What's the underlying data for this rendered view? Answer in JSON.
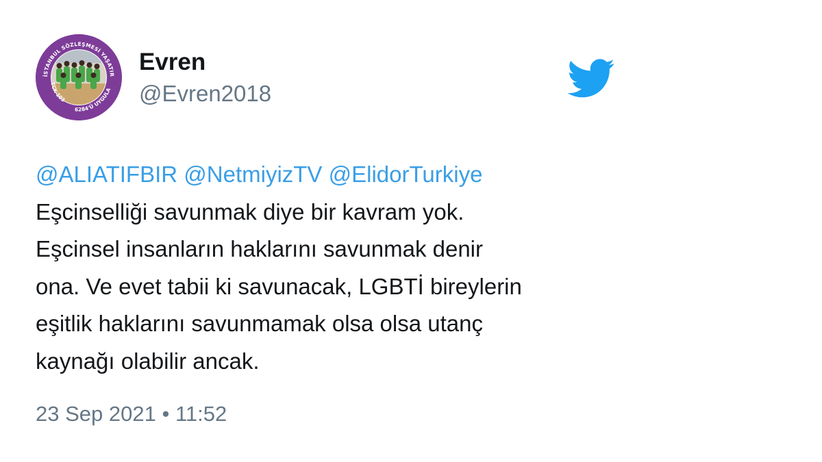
{
  "user": {
    "display_name": "Evren",
    "handle": "@Evren2018",
    "avatar": {
      "ring_text_top": "İSTANBUL SÖZLEŞMESİ YAŞATIR",
      "ring_text_left": "TCK-103",
      "ring_text_bottom": "6284'Ü UYGULA",
      "ring_color": "#7d3c98"
    }
  },
  "brand": {
    "logo_icon": "twitter-bird-icon",
    "logo_color": "#1da1f2"
  },
  "tweet": {
    "mentions": [
      "@ALIATIFBIR",
      "@NetmiyizTV",
      "@ElidorTurkiye"
    ],
    "mention_color": "#3a9ee6",
    "lines": [
      "Eşcinselliği savunmak diye bir kavram yok.",
      "Eşcinsel insanların haklarını savunmak denir",
      "ona. Ve evet tabii ki savunacak, LGBTİ bireylerin",
      "eşitlik haklarını savunmamak olsa olsa utanç",
      "kaynağı olabilir ancak."
    ],
    "date": "23 Sep 2021",
    "separator": "•",
    "time": "11:52"
  }
}
